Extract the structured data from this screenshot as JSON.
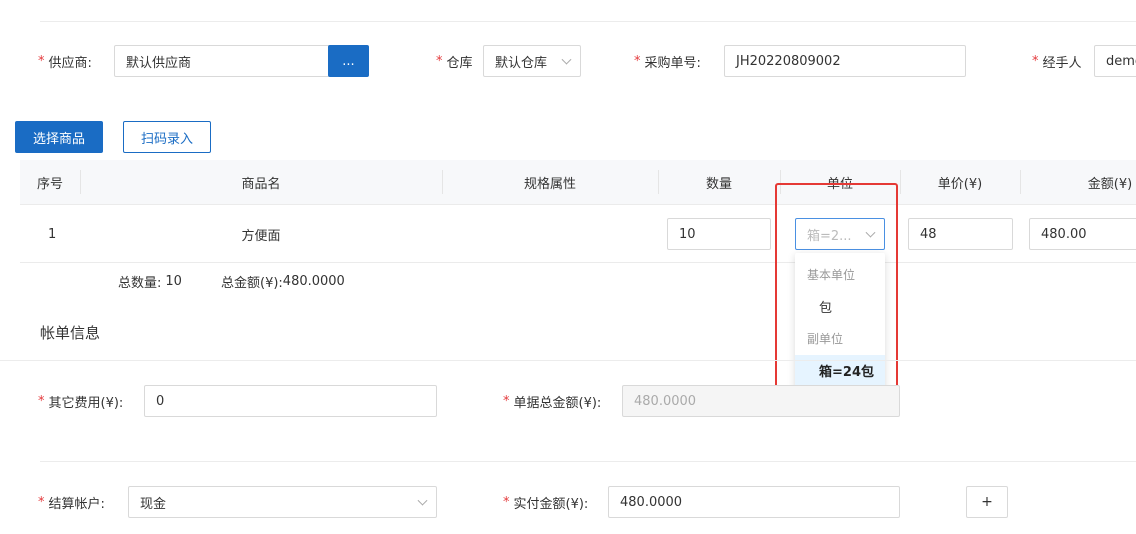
{
  "form": {
    "supplier": {
      "label": "供应商:",
      "value": "默认供应商",
      "picker": "..."
    },
    "warehouse": {
      "label": "仓库",
      "value": "默认仓库"
    },
    "order_no": {
      "label": "采购单号:",
      "value": "JH20220809002"
    },
    "handler": {
      "label": "经手人",
      "value": "demo"
    }
  },
  "toolbar": {
    "select_goods": "选择商品",
    "scan_entry": "扫码录入"
  },
  "table": {
    "headers": [
      "序号",
      "商品名",
      "规格属性",
      "数量",
      "单位",
      "单价(¥)",
      "金额(¥)"
    ],
    "rows": [
      {
        "index": "1",
        "name": "方便面",
        "spec": "",
        "qty": "10",
        "unit": "箱=2...",
        "price": "48",
        "amount": "480.00"
      }
    ],
    "summary": {
      "qty_label": "总数量:",
      "qty_value": "10",
      "amount_label": "总金额(¥):",
      "amount_value": "480.0000"
    }
  },
  "unit_dropdown": {
    "group_base": "基本单位",
    "base_option": "包",
    "group_sub": "副单位",
    "sub_option": "箱=24包"
  },
  "billing": {
    "section_title": "帐单信息",
    "other_fee": {
      "label": "其它费用(¥):",
      "value": "0"
    },
    "total_amount": {
      "label": "单据总金额(¥):",
      "value": "480.0000"
    },
    "account": {
      "label": "结算帐户:",
      "value": "现金"
    },
    "paid_amount": {
      "label": "实付金额(¥):",
      "value": "480.0000"
    },
    "add_label": "+"
  },
  "colors": {
    "primary": "#1a6cc4",
    "required": "#e4393c",
    "highlight_box": "#e53935",
    "dropdown_selected_bg": "#e6f4ff"
  }
}
